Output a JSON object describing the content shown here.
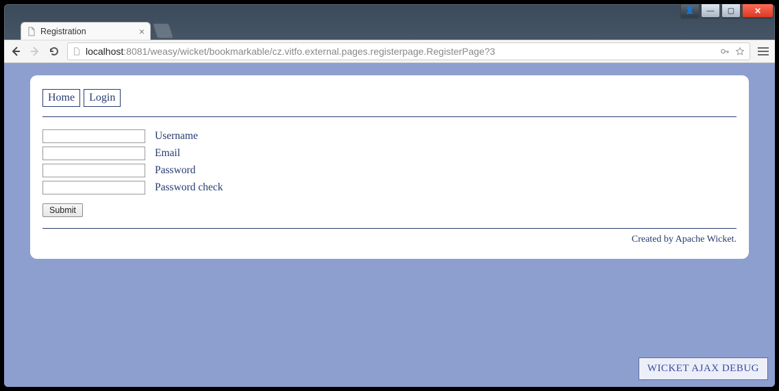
{
  "window": {
    "user_btn_glyph": "👤",
    "min_glyph": "—",
    "max_glyph": "▢",
    "close_glyph": "✕"
  },
  "tab": {
    "title": "Registration",
    "close_glyph": "×"
  },
  "toolbar": {
    "back_icon_label": "←",
    "forward_icon_label": "→",
    "reload_icon_label": "⟳"
  },
  "url": {
    "host": "localhost",
    "rest": ":8081/weasy/wicket/bookmarkable/cz.vitfo.external.pages.registerpage.RegisterPage?3"
  },
  "nav": {
    "home": "Home",
    "login": "Login"
  },
  "form": {
    "fields": [
      {
        "label": "Username",
        "type": "text"
      },
      {
        "label": "Email",
        "type": "text"
      },
      {
        "label": "Password",
        "type": "password"
      },
      {
        "label": "Password check",
        "type": "password"
      }
    ],
    "submit_label": "Submit"
  },
  "footer": {
    "prefix": "Created by ",
    "link_text": "Apache Wicket",
    "suffix": "."
  },
  "debug": {
    "label": "WICKET AJAX DEBUG"
  }
}
